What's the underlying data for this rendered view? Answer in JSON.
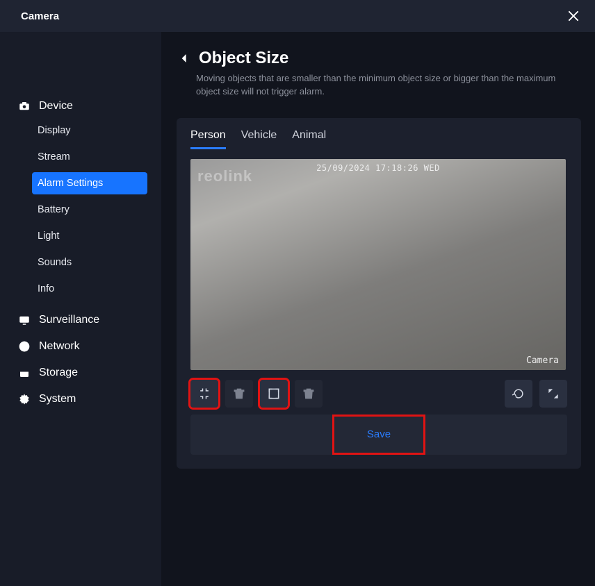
{
  "topbar": {
    "title": "Camera"
  },
  "sidebar": {
    "groups": [
      {
        "label": "Device",
        "items": [
          "Display",
          "Stream",
          "Alarm Settings",
          "Battery",
          "Light",
          "Sounds",
          "Info"
        ],
        "active_index": 2
      },
      {
        "label": "Surveillance"
      },
      {
        "label": "Network"
      },
      {
        "label": "Storage"
      },
      {
        "label": "System"
      }
    ]
  },
  "page": {
    "title": "Object Size",
    "description": "Moving objects that are smaller than the minimum object size or bigger than the maximum object size will not trigger alarm."
  },
  "tabs": {
    "items": [
      "Person",
      "Vehicle",
      "Animal"
    ],
    "active_index": 0
  },
  "preview": {
    "watermark": "reolink",
    "timestamp": "25/09/2024 17:18:26 WED",
    "camera_label": "Camera"
  },
  "actions": {
    "save_label": "Save"
  }
}
